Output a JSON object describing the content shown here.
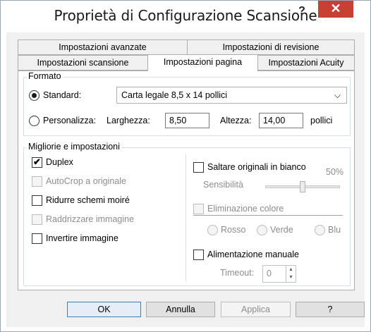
{
  "window": {
    "title": "Proprietà di Configurazione Scansione",
    "help_label": "?",
    "close_label": "✕"
  },
  "tabs": {
    "row1": [
      {
        "label": "Impostazioni avanzate"
      },
      {
        "label": "Impostazioni di revisione"
      }
    ],
    "row2": [
      {
        "label": "Impostazioni scansione",
        "active": false
      },
      {
        "label": "Impostazioni pagina",
        "active": true
      },
      {
        "label": "Impostazioni Acuity",
        "active": false
      }
    ]
  },
  "formato": {
    "group_label": "Formato",
    "standard": {
      "label": "Standard:",
      "selected": true,
      "value": "Carta legale 8,5 x 14 pollici"
    },
    "personalizza": {
      "label": "Personalizza:",
      "selected": false,
      "larghezza_label": "Larghezza:",
      "larghezza_value": "8,50",
      "altezza_label": "Altezza:",
      "altezza_value": "14,00",
      "unit": "pollici"
    }
  },
  "migliorie": {
    "group_label": "Migliorie e impostazioni",
    "left": [
      {
        "label": "Duplex",
        "checked": true,
        "enabled": true
      },
      {
        "label": "AutoCrop a originale",
        "checked": false,
        "enabled": false
      },
      {
        "label": "Ridurre schemi moiré",
        "checked": false,
        "enabled": true
      },
      {
        "label": "Raddrizzare immagine",
        "checked": false,
        "enabled": false
      },
      {
        "label": "Invertire immagine",
        "checked": false,
        "enabled": true
      }
    ],
    "saltare": {
      "label": "Saltare originali in bianco",
      "checked": false,
      "percent": "50%",
      "sensibilita_label": "Sensibilità",
      "level": 0.5
    },
    "eliminazione": {
      "label": "Eliminazione colore",
      "checked": false,
      "enabled": false,
      "options": [
        "Rosso",
        "Verde",
        "Blu"
      ]
    },
    "alimentazione": {
      "label": "Alimentazione manuale",
      "checked": false,
      "timeout_label": "Timeout:",
      "timeout_value": "0"
    }
  },
  "buttons": {
    "ok": "OK",
    "annulla": "Annulla",
    "applica": "Applica",
    "help": "?"
  },
  "icons": {
    "check": "✔",
    "chevron_down": "⌵",
    "spin_up": "▲",
    "spin_down": "▼"
  }
}
